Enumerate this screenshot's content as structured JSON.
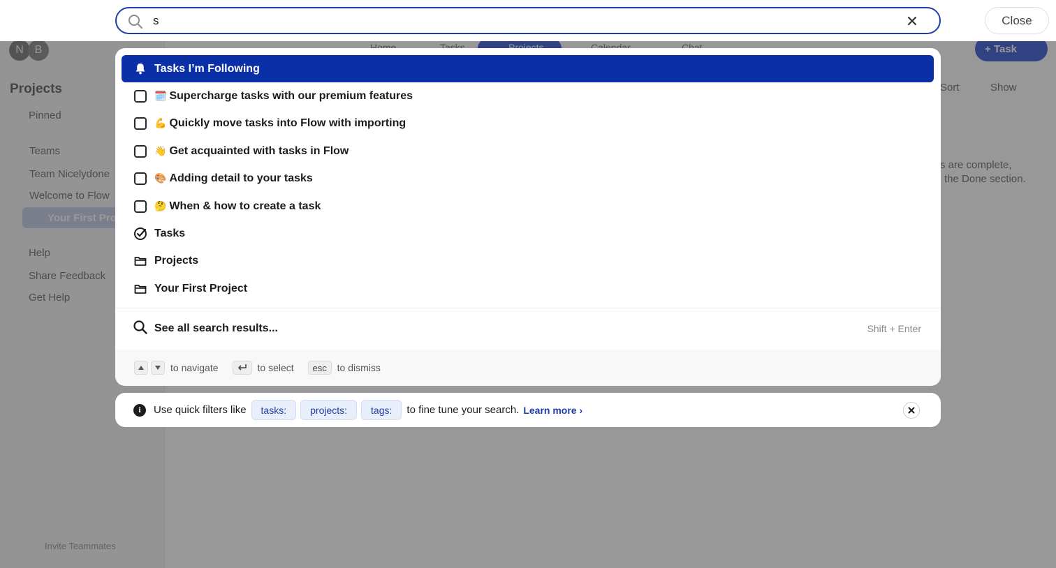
{
  "search": {
    "value": "s",
    "placeholder": ""
  },
  "topbar": {
    "close_label": "Close"
  },
  "background": {
    "avatars": [
      "N",
      "B"
    ],
    "sidebar_heading": "Projects",
    "sidebar_items": [
      "Pinned",
      "Teams",
      "Team Nicelydone",
      "Welcome to Flow",
      "Your First Pro",
      "Help",
      "Share Feedback",
      "Get Help"
    ],
    "invite_label": "Invite Teammates",
    "nav_tabs": [
      "Home",
      "Tasks",
      "Projects",
      "Calendar",
      "Chat"
    ],
    "task_button": "Task",
    "toolbar": [
      "Sort",
      "Show"
    ],
    "body_text": [
      "s are complete,",
      "the Done section."
    ]
  },
  "results": [
    {
      "type": "following",
      "label": "Tasks I’m Following",
      "emoji": "",
      "active": true
    },
    {
      "type": "task",
      "label": "Supercharge tasks with our premium features",
      "emoji": "🗓️"
    },
    {
      "type": "task",
      "label": "Quickly move tasks into Flow with importing",
      "emoji": "💪"
    },
    {
      "type": "task",
      "label": "Get acquainted with tasks in Flow",
      "emoji": "👋"
    },
    {
      "type": "task",
      "label": "Adding detail to your tasks",
      "emoji": "🎨"
    },
    {
      "type": "task",
      "label": "When & how to create a task",
      "emoji": "🤔"
    },
    {
      "type": "section",
      "label": "Tasks",
      "emoji": ""
    },
    {
      "type": "folder",
      "label": "Projects",
      "emoji": ""
    },
    {
      "type": "folder",
      "label": "Your First Project",
      "emoji": ""
    }
  ],
  "see_all": {
    "label": "See all search results...",
    "hint": "Shift + Enter"
  },
  "footer": {
    "navigate": "to navigate",
    "select": "to select",
    "esc_key": "esc",
    "dismiss": "to dismiss"
  },
  "tips": {
    "prefix": "Use quick filters like",
    "chips": [
      "tasks:",
      "projects:",
      "tags:"
    ],
    "suffix": "to fine tune your search.",
    "learn_more": "Learn more ›"
  },
  "colors": {
    "accent": "#0b2fa6",
    "search_border": "#1f3da8"
  }
}
